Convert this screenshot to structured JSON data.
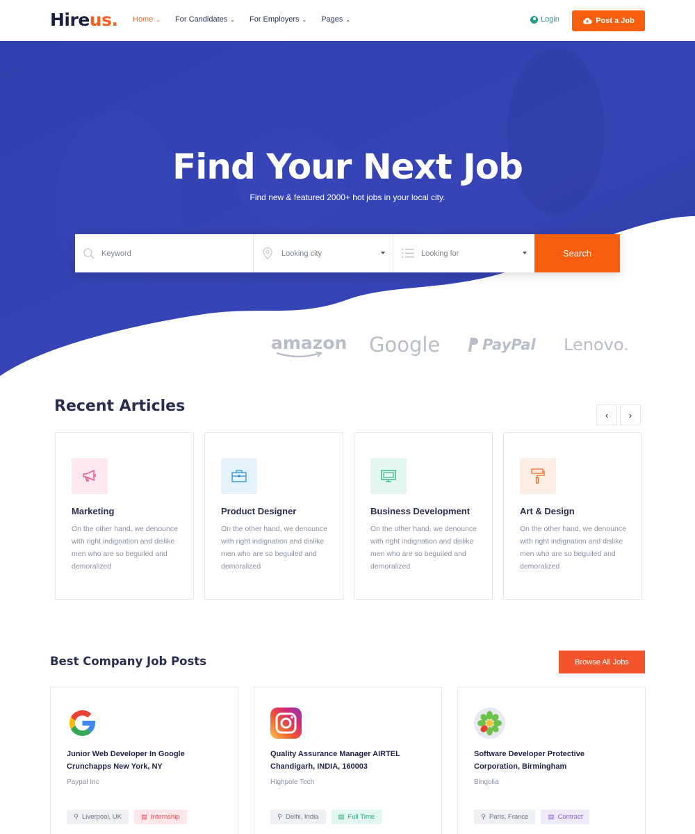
{
  "nav": {
    "logo_main": "Hire",
    "logo_accent": "us.",
    "menu": [
      {
        "label": "Home"
      },
      {
        "label": "For Candidates"
      },
      {
        "label": "For Employers"
      },
      {
        "label": "Pages"
      }
    ],
    "login": "Login",
    "post_job": "Post a Job"
  },
  "hero": {
    "title": "Find Your Next Job",
    "subtitle": "Find new & featured 2000+ hot jobs in your local city.",
    "search": {
      "keyword_placeholder": "Keyword",
      "city_placeholder": "Looking city",
      "looking_for_placeholder": "Looking for",
      "button": "Search"
    },
    "brands": [
      "amazon",
      "Google",
      "PayPal",
      "Lenovo."
    ]
  },
  "articles": {
    "title": "Recent Articles",
    "prev": "‹",
    "next": "›",
    "items": [
      {
        "title": "Marketing",
        "text": "On the other hand, we denounce with right indignation and dislike men who are so beguiled and demoralized",
        "icon": "megaphone-icon",
        "color": "#e2487d",
        "bg": "#fde8ef"
      },
      {
        "title": "Product Designer",
        "text": "On the other hand, we denounce with right indignation and dislike men who are so beguiled and demoralized",
        "icon": "briefcase-icon",
        "color": "#2a8fd9",
        "bg": "#e4f2fc"
      },
      {
        "title": "Business Development",
        "text": "On the other hand, we denounce with right indignation and dislike men who are so beguiled and demoralized",
        "icon": "monitor-icon",
        "color": "#27b07e",
        "bg": "#e3f6ef"
      },
      {
        "title": "Art & Design",
        "text": "On the other hand, we denounce with right indignation and dislike men who are so beguiled and demoralized",
        "icon": "paint-roller-icon",
        "color": "#f06a2a",
        "bg": "#fdeee4"
      }
    ]
  },
  "jobs": {
    "title": "Best Company Job Posts",
    "browse": "Browse All Jobs",
    "items": [
      {
        "title": "Junior Web Developer In Google Crunchapps New York, NY",
        "company": "Paypal Inc",
        "location": "Liverpool, UK",
        "type": "Internship",
        "logo": "google-logo"
      },
      {
        "title": "Quality Assurance Manager AIRTEL Chandigarh, INDIA, 160003",
        "company": "Highpole Tech",
        "location": "Delhi, India",
        "type": "Full Time",
        "logo": "instagram-logo"
      },
      {
        "title": "Software Developer Protective Corporation, Birmingham",
        "company": "Bingolia",
        "location": "Paris, France",
        "type": "Contract",
        "logo": "icq-logo"
      }
    ]
  },
  "colors": {
    "accent": "#f75e0d",
    "hero_blue": "#3341b3",
    "nav_active": "#f26a2a",
    "login": "#21a087"
  }
}
